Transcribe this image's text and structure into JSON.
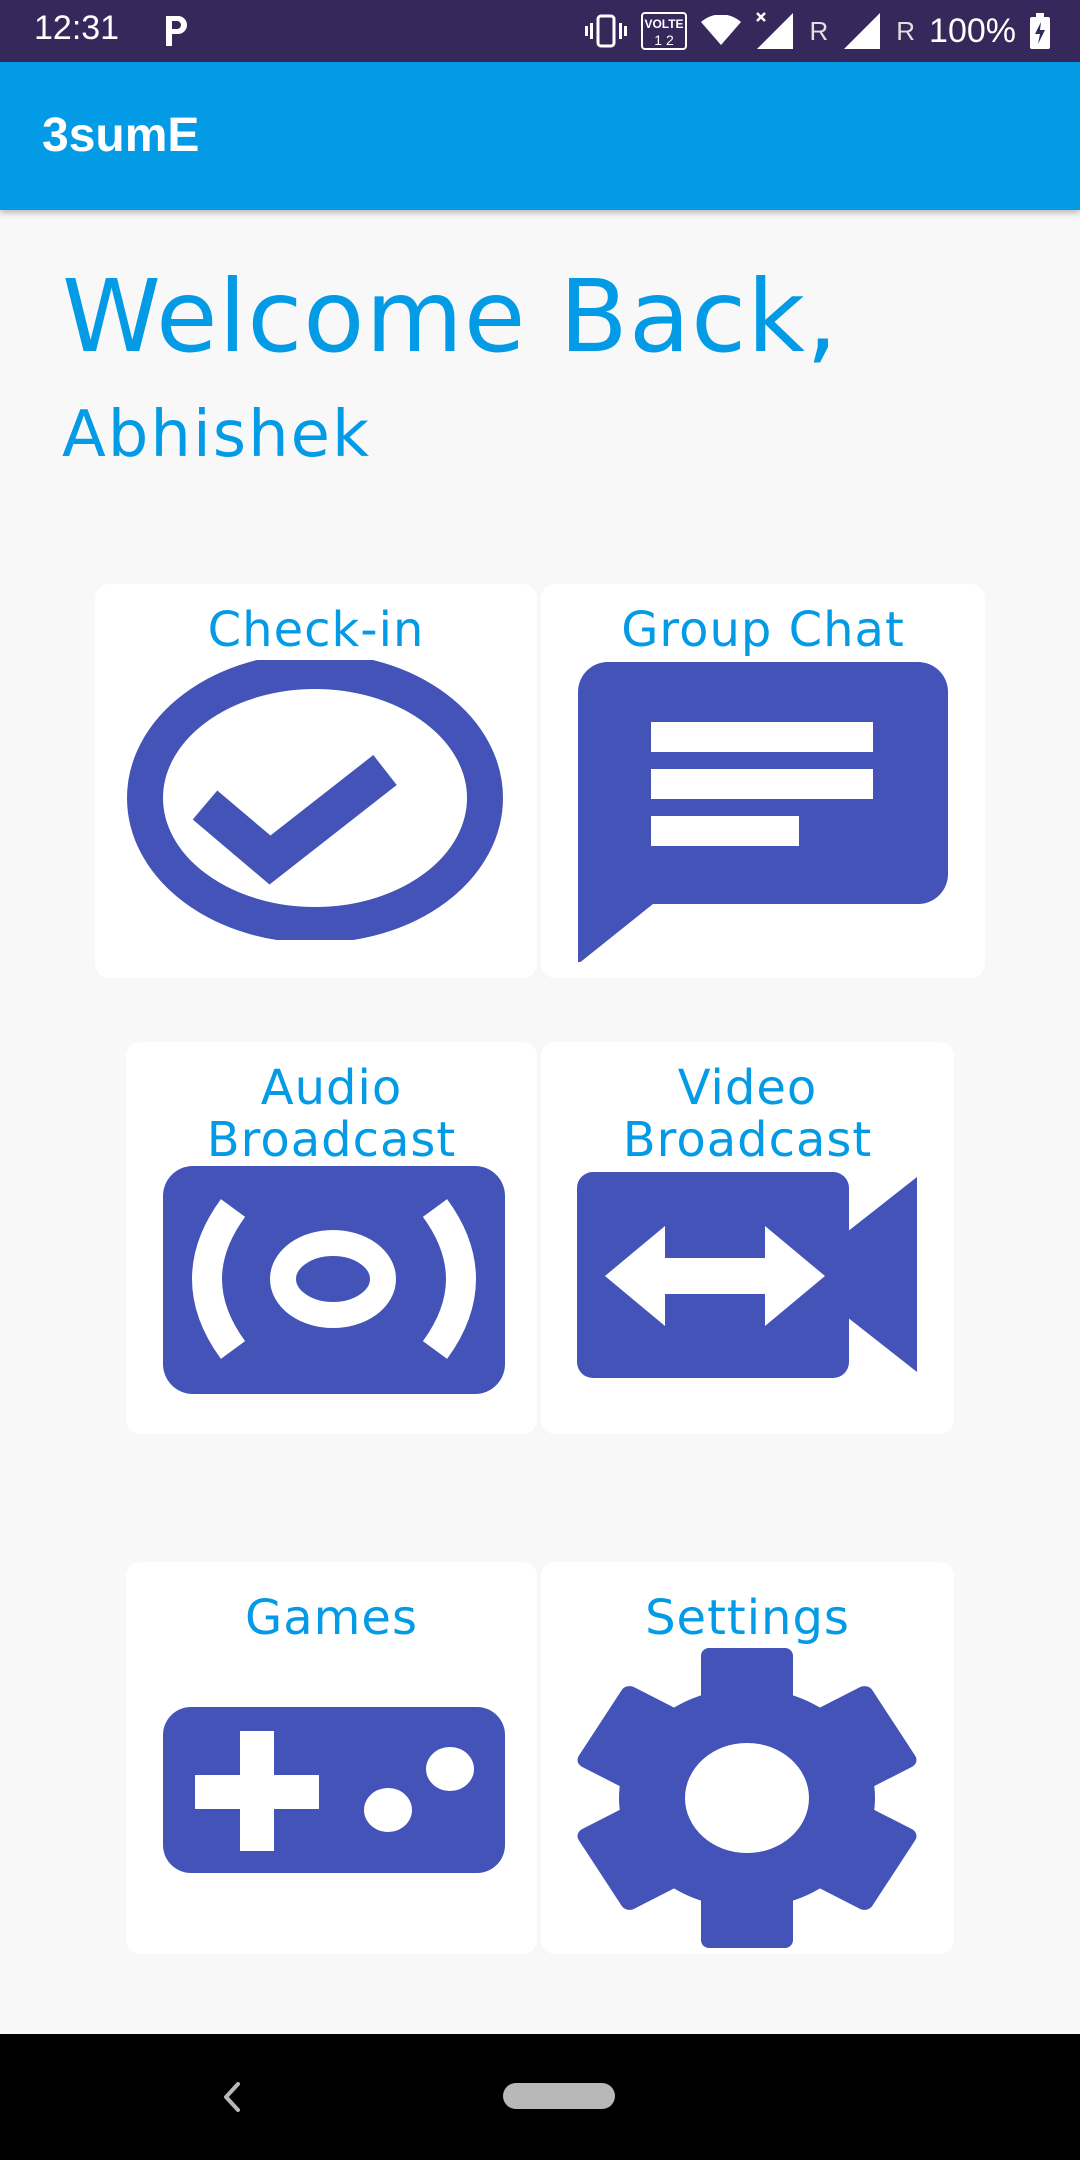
{
  "status_bar": {
    "time": "12:31",
    "volte_label": "VOLTE",
    "sim_label": "1 2",
    "roaming_1": "R",
    "roaming_2": "R",
    "battery": "100%"
  },
  "app_bar": {
    "title": "3sumE"
  },
  "greeting": {
    "welcome": "Welcome Back,",
    "user_name": "Abhishek"
  },
  "tiles": [
    {
      "label": "Check-in",
      "icon": "check-circle-icon"
    },
    {
      "label": "Group Chat",
      "icon": "chat-message-icon"
    },
    {
      "label": "Audio Broadcast",
      "label_line1": "Audio",
      "label_line2": "Broadcast",
      "icon": "broadcast-icon"
    },
    {
      "label": "Video Broadcast",
      "label_line1": "Video",
      "label_line2": "Broadcast",
      "icon": "video-camera-icon"
    },
    {
      "label": "Games",
      "icon": "gamepad-icon"
    },
    {
      "label": "Settings",
      "icon": "gear-icon"
    }
  ],
  "colors": {
    "status_bar": "#36285a",
    "app_bar": "#039be5",
    "accent_text": "#039be5",
    "icon_fill": "#4353b8",
    "background": "#f8f8f8",
    "tile": "#ffffff",
    "nav_bar": "#000000"
  },
  "nav_bar": {
    "back_icon": "back-chevron-icon",
    "home_icon": "home-pill-icon"
  }
}
